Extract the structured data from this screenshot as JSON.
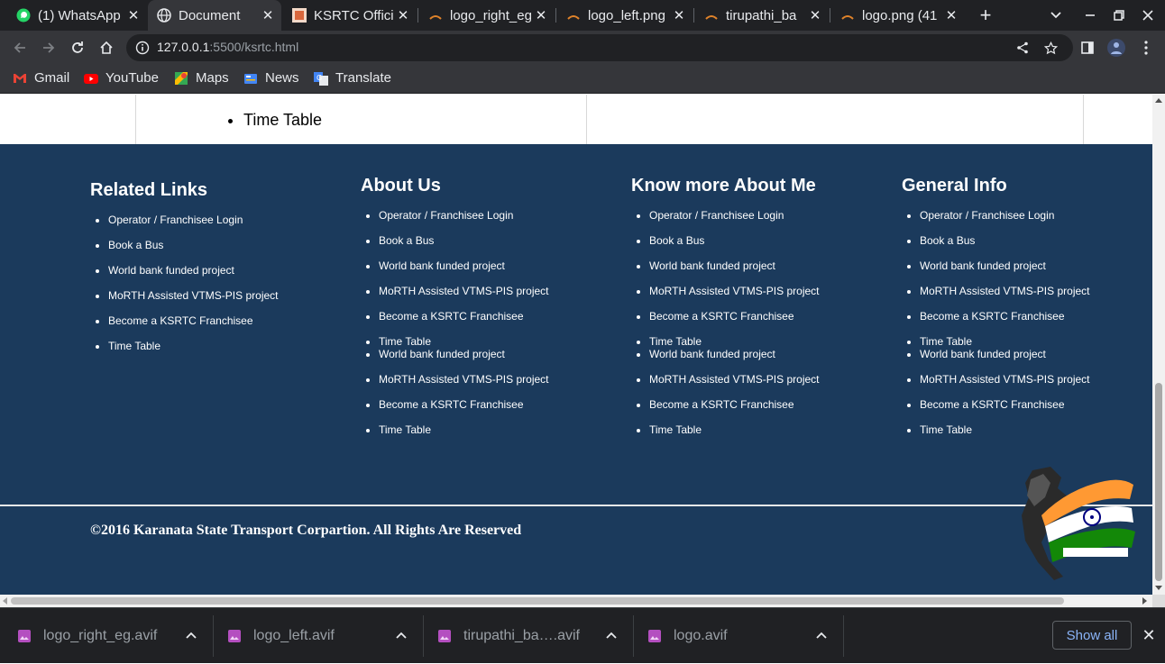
{
  "tabs": [
    {
      "title": "(1) WhatsApp",
      "icon": "whatsapp-icon",
      "active": false
    },
    {
      "title": "Document",
      "icon": "globe-icon",
      "active": true
    },
    {
      "title": "KSRTC Official",
      "icon": "ksrtc-favicon-icon",
      "active": false
    },
    {
      "title": "logo_right_eg",
      "icon": "image-file-icon",
      "active": false
    },
    {
      "title": "logo_left.png",
      "icon": "image-file-icon",
      "active": false
    },
    {
      "title": "tirupathi_ba",
      "icon": "image-file-icon",
      "active": false
    },
    {
      "title": "logo.png (41",
      "icon": "image-file-icon",
      "active": false
    }
  ],
  "address_bar": {
    "host": "127.0.0.1",
    "path": ":5500/ksrtc.html"
  },
  "bookmarks": [
    {
      "label": "Gmail",
      "icon": "gmail-icon"
    },
    {
      "label": "YouTube",
      "icon": "youtube-icon"
    },
    {
      "label": "Maps",
      "icon": "maps-icon"
    },
    {
      "label": "News",
      "icon": "news-icon"
    },
    {
      "label": "Translate",
      "icon": "translate-icon"
    }
  ],
  "page": {
    "top_list_item": "Time Table",
    "columns": [
      {
        "heading": "Related Links",
        "items": [
          "Operator / Franchisee Login",
          "Book a Bus",
          "World bank funded project",
          "MoRTH Assisted VTMS-PIS project",
          "Become a KSRTC Franchisee",
          "Time Table"
        ]
      },
      {
        "heading": "About Us",
        "items": [
          "Operator / Franchisee Login",
          "Book a Bus",
          "World bank funded project",
          "MoRTH Assisted VTMS-PIS project",
          "Become a KSRTC Franchisee",
          "Time Table",
          "World bank funded project",
          "MoRTH Assisted VTMS-PIS project",
          "Become a KSRTC Franchisee",
          "Time Table"
        ]
      },
      {
        "heading": "Know more About Me",
        "items": [
          "Operator / Franchisee Login",
          "Book a Bus",
          "World bank funded project",
          "MoRTH Assisted VTMS-PIS project",
          "Become a KSRTC Franchisee",
          "Time Table",
          "World bank funded project",
          "MoRTH Assisted VTMS-PIS project",
          "Become a KSRTC Franchisee",
          "Time Table"
        ]
      },
      {
        "heading": "General Info",
        "items": [
          "Operator / Franchisee Login",
          "Book a Bus",
          "World bank funded project",
          "MoRTH Assisted VTMS-PIS project",
          "Become a KSRTC Franchisee",
          "Time Table",
          "World bank funded project",
          "MoRTH Assisted VTMS-PIS project",
          "Become a KSRTC Franchisee",
          "Time Table"
        ]
      }
    ],
    "copyright": "©2016 Karanata State Transport Corpartion. All Rights Are Reserved",
    "footer_bg": "#1b3a5c"
  },
  "downloads": [
    {
      "name": "logo_right_eg.avif"
    },
    {
      "name": "logo_left.avif"
    },
    {
      "name": "tirupathi_ba….avif"
    },
    {
      "name": "logo.avif"
    }
  ],
  "show_all_label": "Show all"
}
